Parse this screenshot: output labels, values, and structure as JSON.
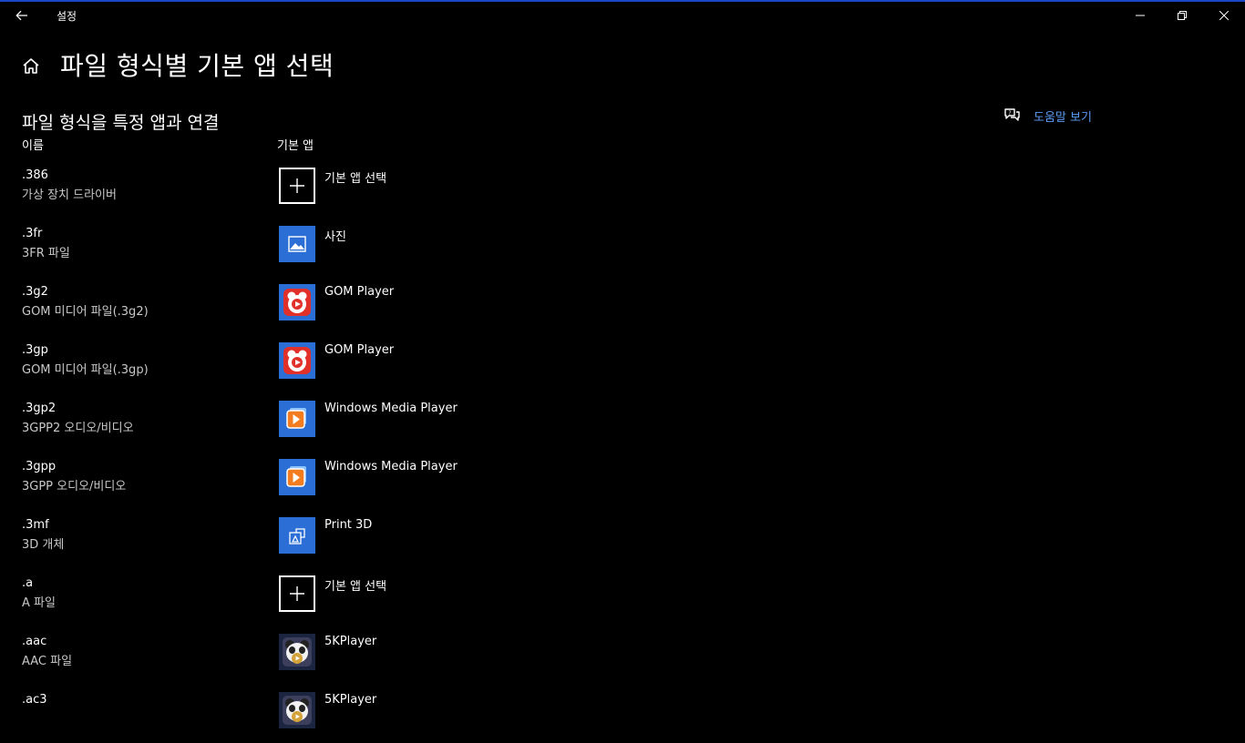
{
  "window": {
    "title": "설정",
    "accent_color": "#1a47c8"
  },
  "page": {
    "title": "파일 형식별 기본 앱 선택",
    "section_title": "파일 형식을 특정 앱과 연결",
    "column_name": "이름",
    "column_app": "기본 앱",
    "help_link": "도움말 보기"
  },
  "icons": {
    "back": "back-arrow-icon",
    "home": "home-icon",
    "help": "help-chat-icon",
    "choose": "plus-icon",
    "photos": "photos-icon",
    "gom": "gom-player-icon",
    "wmp": "windows-media-player-icon",
    "print3d": "print-3d-icon",
    "5kplayer": "5kplayer-icon"
  },
  "rows": [
    {
      "ext": ".386",
      "desc": "가상 장치 드라이버",
      "app": "기본 앱 선택",
      "icon": "choose"
    },
    {
      "ext": ".3fr",
      "desc": "3FR 파일",
      "app": "사진",
      "icon": "photos"
    },
    {
      "ext": ".3g2",
      "desc": "GOM 미디어 파일(.3g2)",
      "app": "GOM Player",
      "icon": "gom"
    },
    {
      "ext": ".3gp",
      "desc": "GOM 미디어 파일(.3gp)",
      "app": "GOM Player",
      "icon": "gom"
    },
    {
      "ext": ".3gp2",
      "desc": "3GPP2 오디오/비디오",
      "app": "Windows Media Player",
      "icon": "wmp"
    },
    {
      "ext": ".3gpp",
      "desc": "3GPP 오디오/비디오",
      "app": "Windows Media Player",
      "icon": "wmp"
    },
    {
      "ext": ".3mf",
      "desc": "3D 개체",
      "app": "Print 3D",
      "icon": "print3d"
    },
    {
      "ext": ".a",
      "desc": "A 파일",
      "app": "기본 앱 선택",
      "icon": "choose"
    },
    {
      "ext": ".aac",
      "desc": "AAC 파일",
      "app": "5KPlayer",
      "icon": "5kplayer"
    },
    {
      "ext": ".ac3",
      "desc": "",
      "app": "5KPlayer",
      "icon": "5kplayer"
    }
  ]
}
